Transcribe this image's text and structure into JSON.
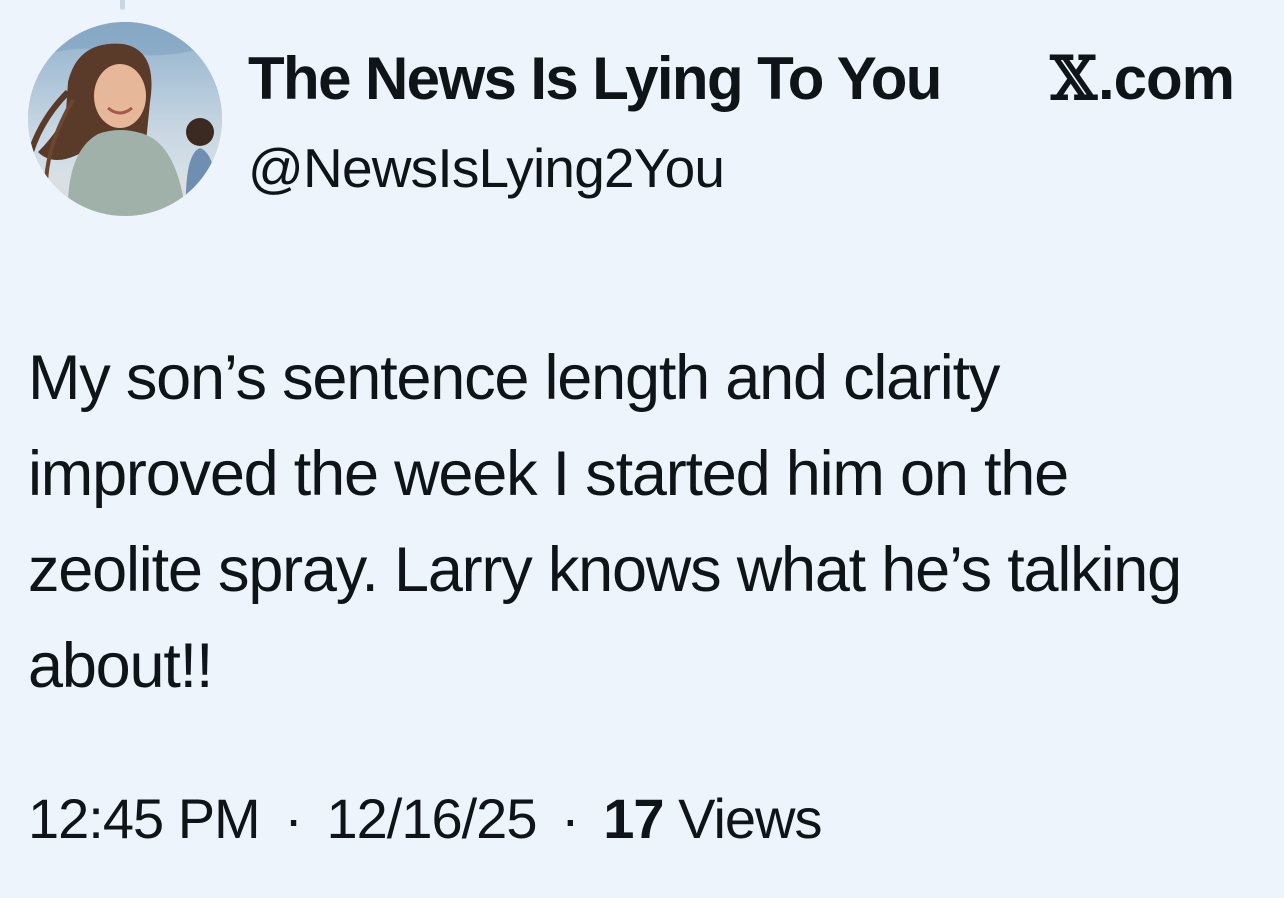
{
  "account": {
    "display_name": "The News Is Lying To You",
    "handle": "@NewsIsLying2You",
    "avatar_icon": "profile-photo-avatar"
  },
  "brand": {
    "glyph": "𝕏",
    "suffix": ".com"
  },
  "tweet": {
    "text": "My son’s sentence length and clarity improved the week I started him on the zeolite spray. Larry knows what he’s talking about!!",
    "time": "12:45 PM",
    "separator": "·",
    "date": "12/16/25",
    "view_count": "17",
    "view_label": "Views"
  },
  "colors": {
    "background": "#eef4fb",
    "text": "#0f1419"
  }
}
